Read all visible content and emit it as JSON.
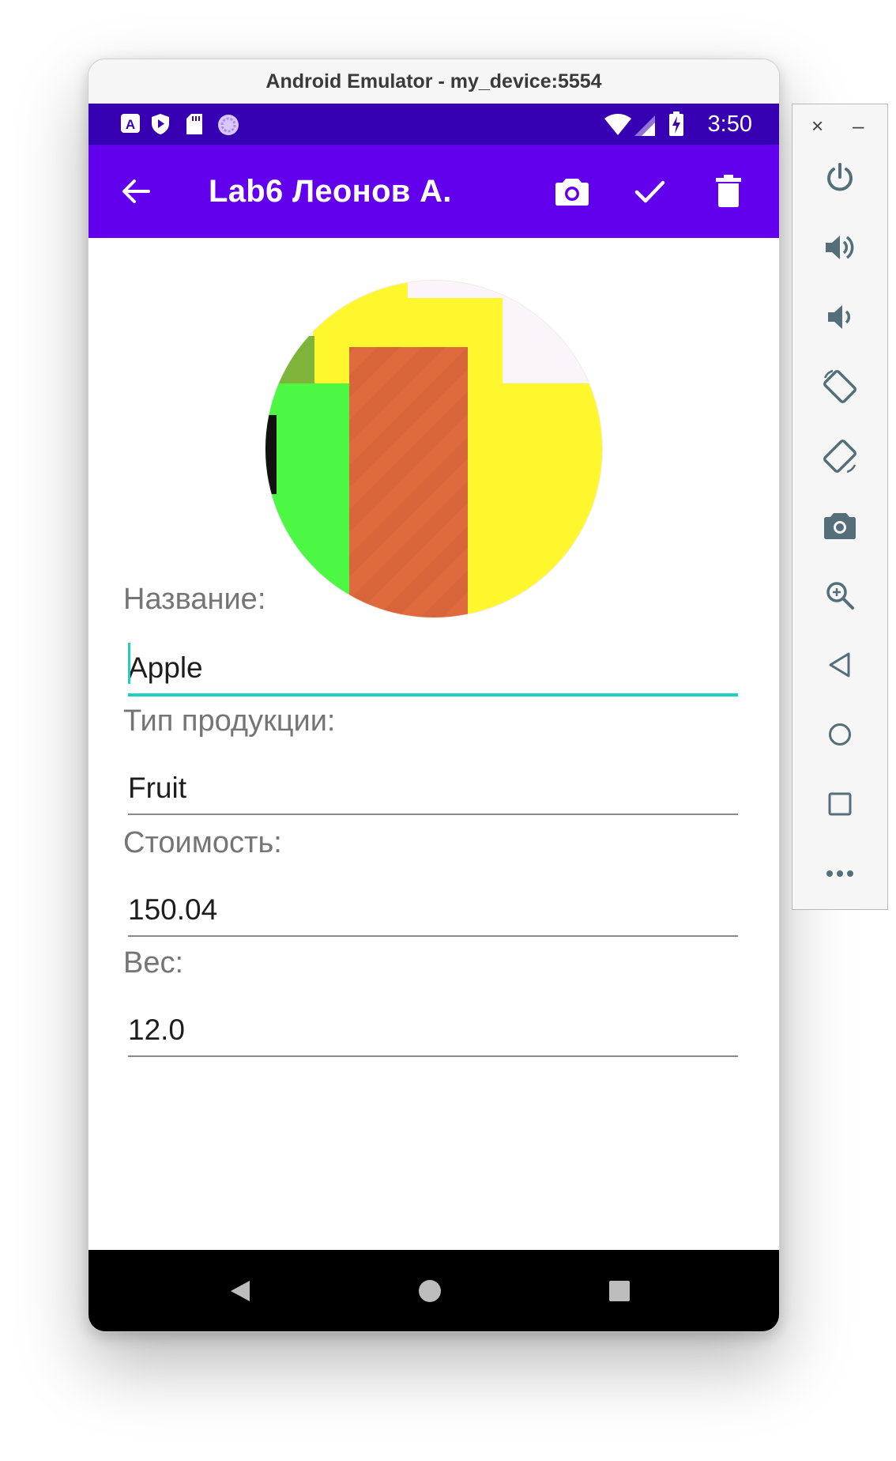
{
  "window": {
    "title": "Android Emulator - my_device:5554"
  },
  "status_bar": {
    "time": "3:50",
    "icons": [
      "a-notification-icon",
      "shield-play-icon",
      "sd-card-icon",
      "sync-circle-icon",
      "wifi-icon",
      "signal-icon",
      "battery-charging-icon"
    ]
  },
  "app_bar": {
    "title": "Lab6 Леонов А.",
    "actions": [
      "back-arrow-icon",
      "camera-icon",
      "check-icon",
      "delete-icon"
    ]
  },
  "form": {
    "name_label": "Название:",
    "name_value": "Apple",
    "type_label": "Тип продукции:",
    "type_value": "Fruit",
    "price_label": "Стоимость:",
    "price_value": "150.04",
    "weight_label": "Вес:",
    "weight_value": "12.0"
  },
  "navigation": [
    "back-triangle-icon",
    "home-circle-icon",
    "recents-square-icon"
  ],
  "side_toolbar": {
    "window_controls": [
      "×",
      "–"
    ],
    "tools": [
      "power-icon",
      "volume-up-icon",
      "volume-down-icon",
      "rotate-left-icon",
      "rotate-right-icon",
      "screenshot-camera-icon",
      "zoom-icon",
      "back-icon",
      "home-icon",
      "overview-icon",
      "more-icon"
    ]
  },
  "colors": {
    "status_bar": "#3700b3",
    "app_bar": "#6200ee",
    "accent": "#1fcfbf",
    "photo_yellow": "#fff72e",
    "photo_green": "#4cf843",
    "photo_orange": "#df6a3d"
  }
}
